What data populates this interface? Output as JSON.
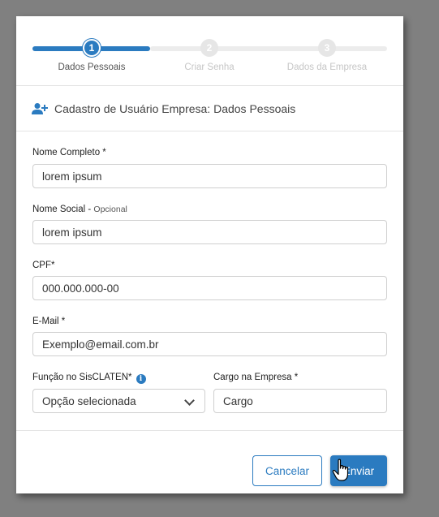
{
  "stepper": {
    "steps": [
      {
        "number": "1",
        "label": "Dados Pessoais",
        "state": "active"
      },
      {
        "number": "2",
        "label": "Criar Senha",
        "state": "inactive"
      },
      {
        "number": "3",
        "label": "Dados da Empresa",
        "state": "inactive"
      }
    ]
  },
  "header": {
    "icon": "add-user-icon",
    "title": "Cadastro de Usuário Empresa: Dados Pessoais"
  },
  "form": {
    "nome_completo": {
      "label": "Nome Completo *",
      "value": "lorem ipsum"
    },
    "nome_social": {
      "label": "Nome Social - ",
      "optional": "Opcional",
      "value": "lorem ipsum"
    },
    "cpf": {
      "label": "CPF*",
      "value": "000.000.000-00"
    },
    "email": {
      "label": "E-Mail *",
      "value": "Exemplo@email.com.br"
    },
    "funcao": {
      "label": "Função no SisCLATEN*",
      "value": "Opção selecionada",
      "info_icon": "info-icon"
    },
    "cargo": {
      "label": "Cargo na Empresa *",
      "value": "Cargo"
    }
  },
  "footer": {
    "cancel_label": "Cancelar",
    "send_label": "Enviar"
  },
  "colors": {
    "accent": "#2b7bc0",
    "background": "#808080"
  }
}
